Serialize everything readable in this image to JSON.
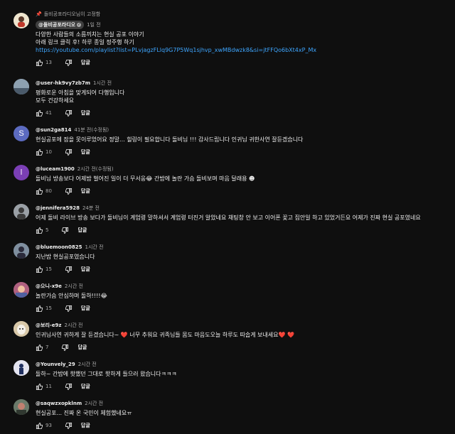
{
  "comments": [
    {
      "pinned_text": "돌비공포라디오님이 고정함",
      "author": "@돌비공포라디오",
      "time": "1일 전",
      "lines": [
        "다양한 사람들의 소름끼치는 현실 공포 이야기",
        "아래 링크 클릭 후! 하루 종일 정주행 하기"
      ],
      "link": "https://youtube.com/playlist?list=PLvjagzFLlq9G7P5Wq1sjhvp_xwMBdwzk8&si=jtFFQo6bXt4xP_Mx",
      "likes": "13",
      "reply": "답글",
      "avatar_bg": "#e8e0c8"
    },
    {
      "author": "@user-hk9vy7zb7m",
      "time": "1시간 전",
      "lines": [
        "평화로운 아침을 맞게되어 다행입니다",
        "모두 건강하세요"
      ],
      "likes": "41",
      "reply": "답글",
      "avatar_bg": "#7a8a9a"
    },
    {
      "author": "@sun2ga814",
      "time": "41분 전(수정됨)",
      "lines": [
        "현실공포에 잠을 못이루었어요 정말... 힐링이 필요합니다 돌비님 !!! 감사드립니다 인귀님 귀한사연 잘듣겠습니다"
      ],
      "likes": "10",
      "reply": "답글",
      "avatar_letter": "S",
      "avatar_bg": "#5c6bc0"
    },
    {
      "author": "@luceam1900",
      "time": "2시간 전(수정됨)",
      "lines": [
        "돌비님 방송보다 어제밤 벌어진 일이 더 무서웅😂  간밤에 놀란 가슴 돌비보며 마음 달래용 ☻"
      ],
      "likes": "80",
      "reply": "답글",
      "avatar_letter": "l",
      "avatar_bg": "#7b3fb5"
    },
    {
      "author": "@jennifera5928",
      "time": "24분 전",
      "lines": [
        "어제 돌비 라이브 방송 보다가 돌비님이 계엄령 말하셔서 계엄령 터진거 알았네요 채팅창 안 보고 이어폰 꽂고 집안일 하고 있었거든요  어제가 진짜 현실 공포였네요"
      ],
      "likes": "5",
      "reply": "답글",
      "avatar_bg": "#8a8a8a"
    },
    {
      "author": "@bluemoon0825",
      "time": "1시간 전",
      "lines": [
        "지난밤 현실공포였습니다"
      ],
      "likes": "15",
      "reply": "답글",
      "avatar_bg": "#6f7f8f"
    },
    {
      "author": "@으니-x9e",
      "time": "2시간 전",
      "lines": [
        "놀란가슴 안심하며 돌하!!!!😂"
      ],
      "likes": "15",
      "reply": "답글",
      "avatar_bg": "#9a5a6a"
    },
    {
      "author": "@보리-e9z",
      "time": "2시간 전",
      "lines": [
        "인귀님사연 귀하게 잘 듣겠습니다~ ❤️  너무 추워요 귀족님들 몸도 마음도오늘 하루도 따숩게 보내세요❤️ ❤️"
      ],
      "likes": "7",
      "reply": "답글",
      "avatar_bg": "#c8b090"
    },
    {
      "author": "@Younvely_29",
      "time": "2시간 전",
      "lines": [
        "돌하~ 간밤에 핫했던 그대로 핫하게 들으러 왔습니다ㅋㅋㅋ"
      ],
      "likes": "11",
      "reply": "답글",
      "avatar_bg": "#d8d8e8"
    },
    {
      "author": "@saqwzxopklnm",
      "time": "2시간 전",
      "lines": [
        "현실공포... 진짜 온 국민이 체험했네요ㅠ"
      ],
      "likes": "93",
      "reply": "답글",
      "avatar_bg": "#5a6a5a"
    }
  ]
}
